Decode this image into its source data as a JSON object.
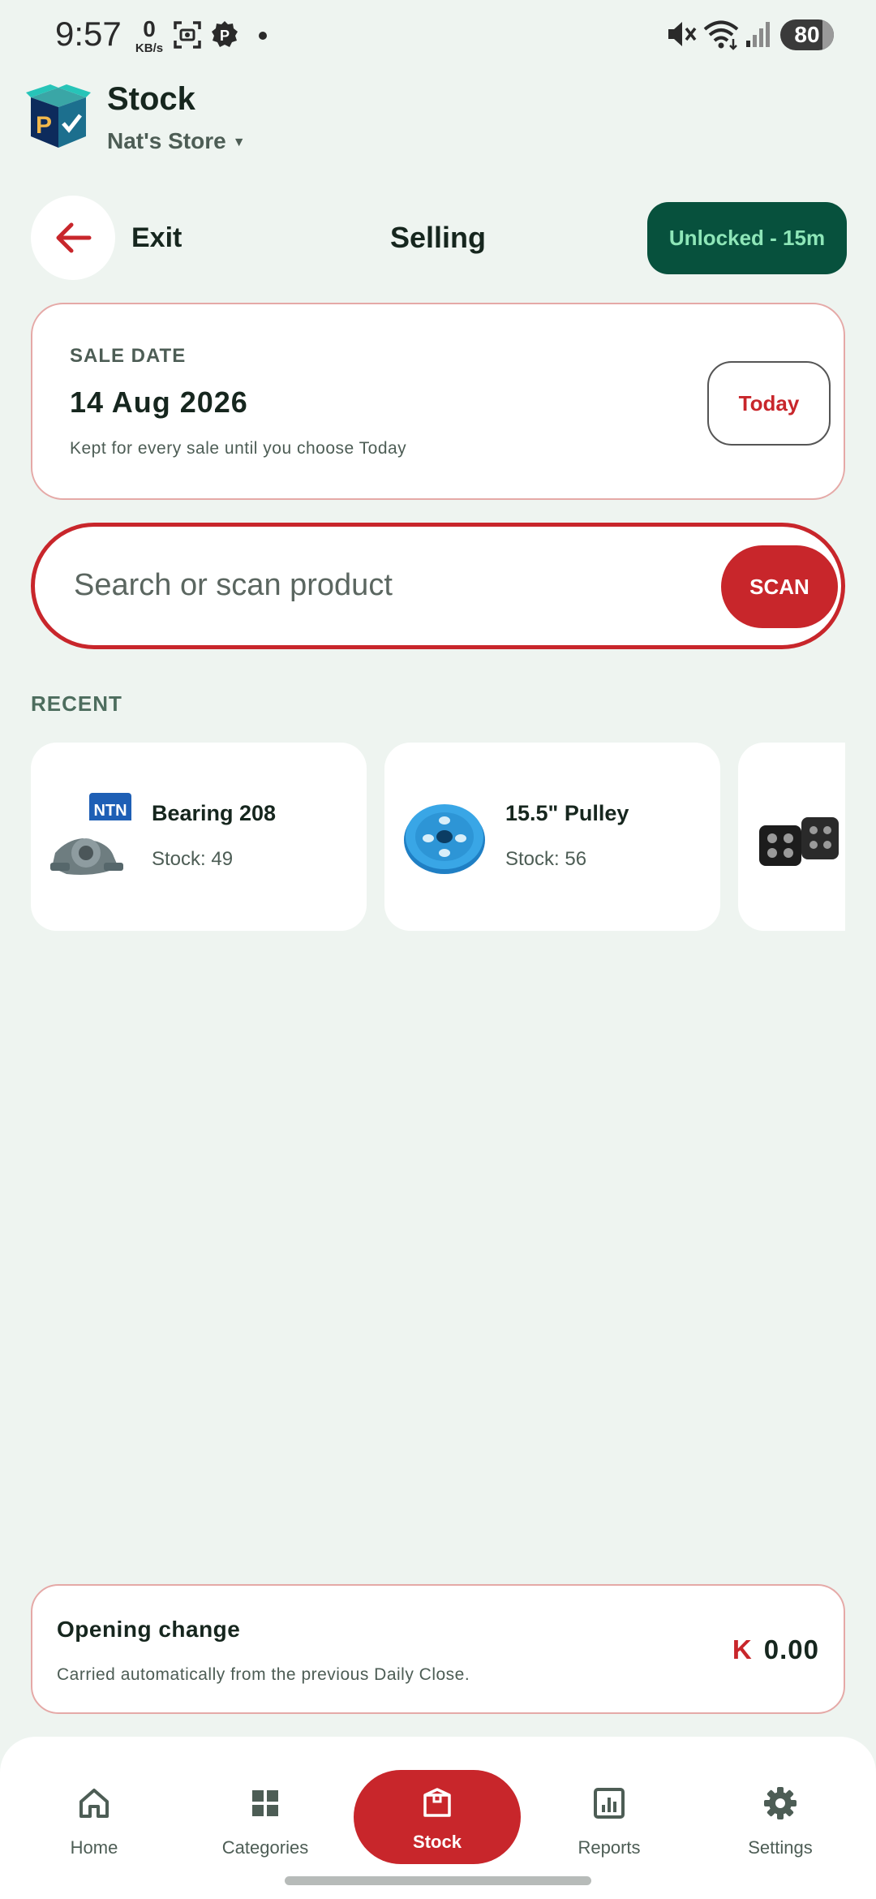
{
  "status_bar": {
    "time": "9:57",
    "net_speed_value": "0",
    "net_speed_unit": "KB/s",
    "battery": "80",
    "icons": [
      "screenshot-icon",
      "parking-icon",
      "notification-dot-icon",
      "muted-icon",
      "wifi-icon",
      "signal-icon",
      "battery-icon"
    ]
  },
  "app": {
    "title": "Stock",
    "store": "Nat's Store",
    "logo": "app-logo-box-icon"
  },
  "actions": {
    "exit_label": "Exit",
    "page_title": "Selling",
    "unlock_label": "Unlocked - 15m"
  },
  "sale_date": {
    "label": "SALE DATE",
    "value": "14 Aug 2026",
    "hint": "Kept for every sale until you choose Today",
    "today_button": "Today"
  },
  "search": {
    "placeholder": "Search or scan product",
    "scan_button": "SCAN"
  },
  "recent": {
    "label": "RECENT",
    "items": [
      {
        "name": "Bearing 208",
        "stock": "Stock: 49",
        "image": "bearing-image"
      },
      {
        "name": "15.5\" Pulley",
        "stock": "Stock: 56",
        "image": "pulley-image"
      },
      {
        "name": "",
        "stock": "",
        "image": "led-lights-image"
      }
    ]
  },
  "opening_change": {
    "title": "Opening change",
    "description": "Carried automatically from the previous Daily Close.",
    "currency": "K",
    "amount": "0.00"
  },
  "nav": {
    "items": [
      {
        "label": "Home",
        "icon": "home-icon"
      },
      {
        "label": "Categories",
        "icon": "grid-icon"
      },
      {
        "label": "Stock",
        "icon": "box-icon",
        "active": true
      },
      {
        "label": "Reports",
        "icon": "chart-icon"
      },
      {
        "label": "Settings",
        "icon": "gear-icon"
      }
    ]
  },
  "colors": {
    "background": "#eef4f0",
    "accent_red": "#c8262b",
    "dark_green": "#07513d",
    "mint_text": "#8ee6b8",
    "card_border": "#e5a9a7"
  }
}
